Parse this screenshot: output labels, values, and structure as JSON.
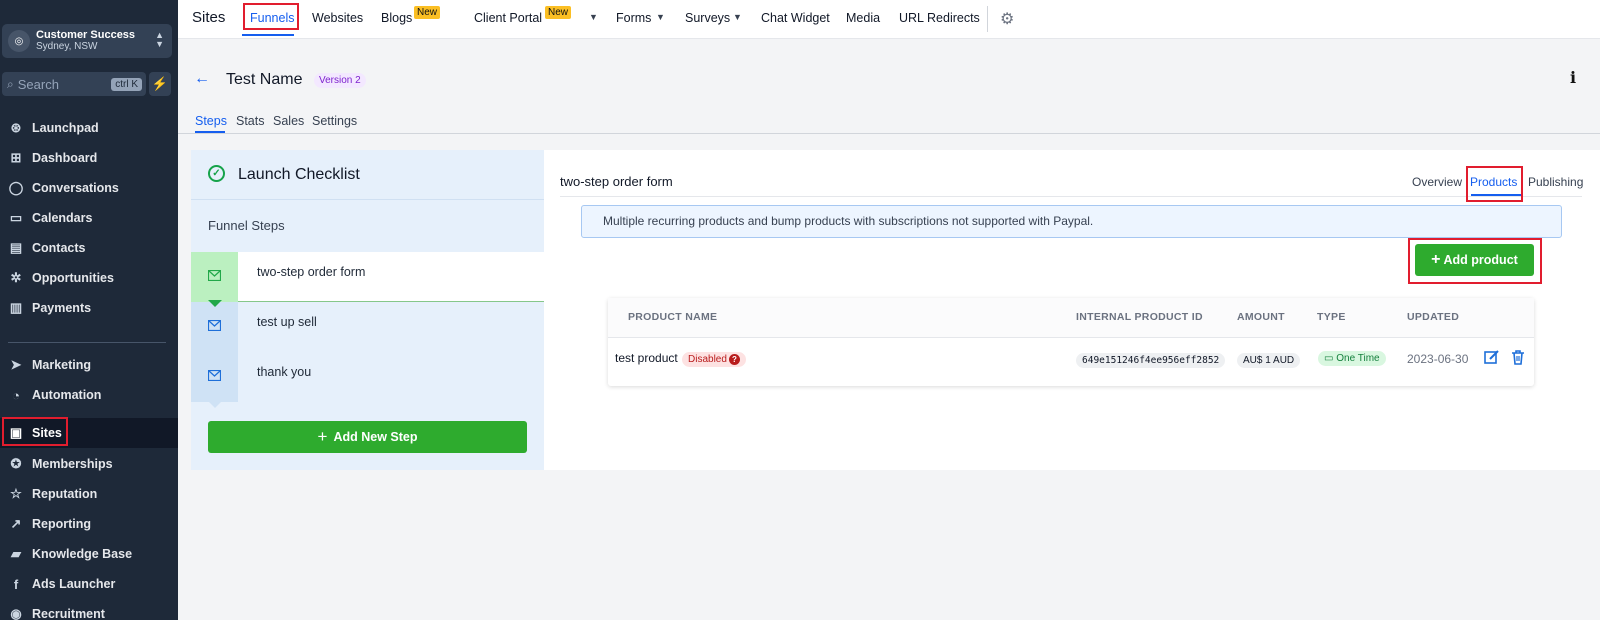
{
  "account": {
    "name": "Customer Success",
    "location": "Sydney, NSW"
  },
  "search": {
    "placeholder": "Search",
    "shortcut": "ctrl K"
  },
  "sidebar": {
    "items": [
      {
        "label": "Launchpad",
        "icon": "rocket-icon"
      },
      {
        "label": "Dashboard",
        "icon": "grid-icon"
      },
      {
        "label": "Conversations",
        "icon": "chat-icon"
      },
      {
        "label": "Calendars",
        "icon": "calendar-icon"
      },
      {
        "label": "Contacts",
        "icon": "contacts-icon"
      },
      {
        "label": "Opportunities",
        "icon": "network-icon"
      },
      {
        "label": "Payments",
        "icon": "receipt-icon"
      },
      {
        "label": "Marketing",
        "icon": "send-icon"
      },
      {
        "label": "Automation",
        "icon": "automation-icon"
      },
      {
        "label": "Sites",
        "icon": "globe-icon"
      },
      {
        "label": "Memberships",
        "icon": "award-icon"
      },
      {
        "label": "Reputation",
        "icon": "star-icon"
      },
      {
        "label": "Reporting",
        "icon": "trend-icon"
      },
      {
        "label": "Knowledge Base",
        "icon": "book-icon"
      },
      {
        "label": "Ads Launcher",
        "icon": "facebook-icon"
      },
      {
        "label": "Recruitment",
        "icon": "recruitment-icon"
      }
    ]
  },
  "topnav": {
    "title": "Sites",
    "items": [
      "Funnels",
      "Websites",
      "Blogs",
      "Client Portal",
      "Forms",
      "Surveys",
      "Chat Widget",
      "Media",
      "URL Redirects"
    ],
    "new_badge": "New"
  },
  "page": {
    "back_icon": "arrow-left-icon",
    "title": "Test Name",
    "version": "Version 2",
    "info": "i",
    "tabs": [
      "Steps",
      "Stats",
      "Sales",
      "Settings"
    ]
  },
  "checklist": {
    "title": "Launch Checklist",
    "funnel_steps_label": "Funnel Steps",
    "steps": [
      "two-step order form",
      "test up sell",
      "thank you"
    ],
    "add_step_label": "Add New Step"
  },
  "step_detail": {
    "title": "two-step order form",
    "tabs": [
      "Overview",
      "Products",
      "Publishing"
    ],
    "alert": "Multiple recurring products and bump products with subscriptions not supported with Paypal.",
    "add_product_label": "Add product"
  },
  "products_table": {
    "headers": [
      "PRODUCT NAME",
      "INTERNAL PRODUCT ID",
      "AMOUNT",
      "TYPE",
      "UPDATED"
    ],
    "rows": [
      {
        "name": "test product",
        "status": "Disabled",
        "internal_id": "649e151246f4ee956eff2852",
        "amount": "AU$ 1 AUD",
        "type": "One Time",
        "updated": "2023-06-30"
      }
    ]
  },
  "colors": {
    "accent": "#155eef",
    "primary_button": "#2eab2e",
    "sidebar_bg": "#1e2939",
    "highlight": "#e11d2e"
  }
}
